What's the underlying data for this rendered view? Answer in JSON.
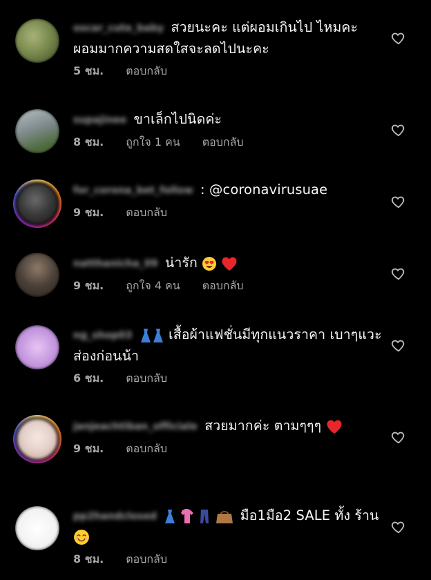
{
  "comments": [
    {
      "username": "oscar_cute_baby",
      "text": "สวยนะคะ  แต่ผอมเกินไป ไหมคะ  ผอมมากความสดใสจะลดไปนะคะ",
      "time": "5 ชม.",
      "likes": "",
      "reply": "ตอบกลับ",
      "avatar_colors": [
        "#7a8a4e",
        "#a8b27a",
        "#3f4a2a"
      ]
    },
    {
      "username": "supajinee",
      "text": "ขาเล็กไปนิดค่ะ",
      "time": "8 ชม.",
      "likes": "ถูกใจ 1 คน",
      "reply": "ตอบกลับ",
      "avatar_colors": [
        "#7e8a8c",
        "#4d6a3a",
        "#b9c2c4"
      ]
    },
    {
      "username": "for_corona_bet_follow",
      "text": ": @coronavirusuae",
      "time": "9 ชม.",
      "likes": "",
      "reply": "ตอบกลับ",
      "avatar_colors": [
        "#3b3b3b",
        "#151515",
        "#6a6a6a"
      ]
    },
    {
      "username": "natthanicha_09",
      "text": "น่ารัก",
      "time": "9 ชม.",
      "likes": "ถูกใจ 4 คน",
      "reply": "ตอบกลับ",
      "avatar_colors": [
        "#4a4038",
        "#8f7a68",
        "#2a241f"
      ]
    },
    {
      "username": "ng_shop03",
      "text": "เสื้อผ้าแฟชั่นมีทุกแนวราคา เบาๆแวะส่องก่อนน้า",
      "time": "6 ชม.",
      "likes": "",
      "reply": "ตอบกลับ",
      "avatar_colors": [
        "#c79be0",
        "#e7c6f3",
        "#a975c9"
      ]
    },
    {
      "username": "janjeachtiban_officiale",
      "text": "สวยมากค่ะ ตามๆๆๆ",
      "time": "9 ชม.",
      "likes": "",
      "reply": "ตอบกลับ",
      "avatar_colors": [
        "#e4cfc8",
        "#f4e8e2",
        "#b89a8f"
      ]
    },
    {
      "username": "pp2handclosed",
      "text": "มือ1มือ2 SALE ทั้ง ร้าน",
      "time": "8 ชม.",
      "likes": "",
      "reply": "ตอบกลับ",
      "avatar_colors": [
        "#f2f2f2",
        "#ffffff",
        "#d9d9d9"
      ]
    }
  ]
}
